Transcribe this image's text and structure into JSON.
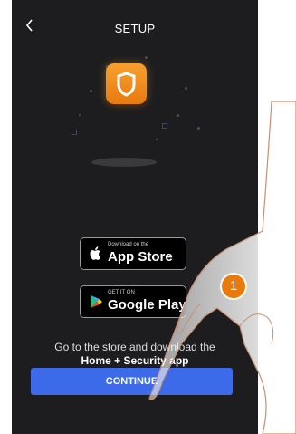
{
  "header": {
    "back_icon": "chevron-left-icon",
    "title": "SETUP"
  },
  "stores": {
    "apple": {
      "caption": "Download on the",
      "label": "App Store",
      "icon": "apple-icon"
    },
    "google": {
      "caption": "GET IT ON",
      "label": "Google Play",
      "icon": "google-play-icon"
    }
  },
  "body": {
    "instruction": "Go to the store and download the",
    "app_name": "Home + Security app"
  },
  "actions": {
    "continue_label": "CONTINUE"
  },
  "overlay": {
    "step_number": "1",
    "step_color": "#e87a0e"
  },
  "colors": {
    "background": "#1d1d1f",
    "button": "#3d6ae8",
    "icon": "#f39021"
  }
}
